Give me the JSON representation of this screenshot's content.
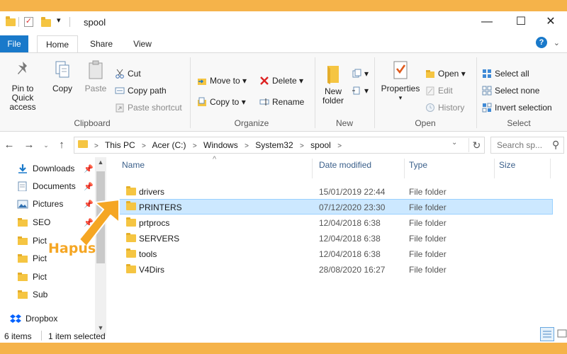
{
  "window": {
    "title": "spool",
    "minimize": "—",
    "maximize": "☐",
    "close": "✕"
  },
  "quick_access": {
    "dropdown": "▾"
  },
  "tabs": [
    {
      "label": "File"
    },
    {
      "label": "Home"
    },
    {
      "label": "Share"
    },
    {
      "label": "View"
    }
  ],
  "ribbon": {
    "help": "?",
    "collapse": "⌄",
    "clipboard": {
      "group_label": "Clipboard",
      "pin": "Pin to Quick access",
      "pin_line1": "Pin to Quick",
      "pin_line2": "access",
      "copy": "Copy",
      "paste": "Paste",
      "cut": "Cut",
      "copy_path": "Copy path",
      "paste_shortcut": "Paste shortcut"
    },
    "organize": {
      "group_label": "Organize",
      "move_to": "Move to",
      "copy_to": "Copy to",
      "delete": "Delete",
      "rename": "Rename"
    },
    "new": {
      "group_label": "New",
      "new_folder_line1": "New",
      "new_folder_line2": "folder"
    },
    "open": {
      "group_label": "Open",
      "properties": "Properties",
      "open": "Open",
      "edit": "Edit",
      "history": "History"
    },
    "select": {
      "group_label": "Select",
      "select_all": "Select all",
      "select_none": "Select none",
      "invert_selection": "Invert selection"
    }
  },
  "address": {
    "back": "←",
    "forward": "→",
    "recent": "⌄",
    "up": "↑",
    "crumbs": [
      "This PC",
      "Acer (C:)",
      "Windows",
      "System32",
      "spool"
    ],
    "crumb_sep": ">",
    "dropdown": "⌄",
    "refresh": "↻",
    "search_placeholder": "Search sp...",
    "search_icon": "⚲"
  },
  "nav_pane": {
    "items": [
      {
        "label": "Downloads",
        "pinned": true,
        "icon": "download-icon"
      },
      {
        "label": "Documents",
        "pinned": true,
        "icon": "documents-icon"
      },
      {
        "label": "Pictures",
        "pinned": true,
        "icon": "pictures-icon"
      },
      {
        "label": "SEO",
        "pinned": true,
        "icon": "folder-icon"
      },
      {
        "label": "Pict",
        "pinned": false,
        "icon": "folder-icon"
      },
      {
        "label": "Pict",
        "pinned": false,
        "icon": "folder-icon"
      },
      {
        "label": "Pict",
        "pinned": false,
        "icon": "folder-icon"
      },
      {
        "label": "Sub",
        "pinned": false,
        "icon": "folder-icon"
      },
      {
        "label": "Dropbox",
        "pinned": false,
        "icon": "dropbox-icon"
      }
    ],
    "pin_glyph": "📌",
    "scroll_up": "▲",
    "scroll_down": "▼"
  },
  "columns": {
    "name": "Name",
    "date": "Date modified",
    "type": "Type",
    "size": "Size",
    "sort_caret": "^"
  },
  "files": [
    {
      "name": "drivers",
      "date": "15/01/2019 22:44",
      "type": "File folder",
      "selected": false
    },
    {
      "name": "PRINTERS",
      "date": "07/12/2020 23:30",
      "type": "File folder",
      "selected": true
    },
    {
      "name": "prtprocs",
      "date": "12/04/2018 6:38",
      "type": "File folder",
      "selected": false
    },
    {
      "name": "SERVERS",
      "date": "12/04/2018 6:38",
      "type": "File folder",
      "selected": false
    },
    {
      "name": "tools",
      "date": "12/04/2018 6:38",
      "type": "File folder",
      "selected": false
    },
    {
      "name": "V4Dirs",
      "date": "28/08/2020 16:27",
      "type": "File folder",
      "selected": false
    }
  ],
  "status": {
    "item_count": "6 items",
    "selection": "1 item selected"
  },
  "annotation": {
    "label": "Hapus",
    "color": "#f5a623"
  },
  "colors": {
    "accent": "#1979ca",
    "selection_bg": "#cce8ff",
    "selection_border": "#99d1ff",
    "frame": "#f5b34a",
    "folder": "#f5c542"
  }
}
